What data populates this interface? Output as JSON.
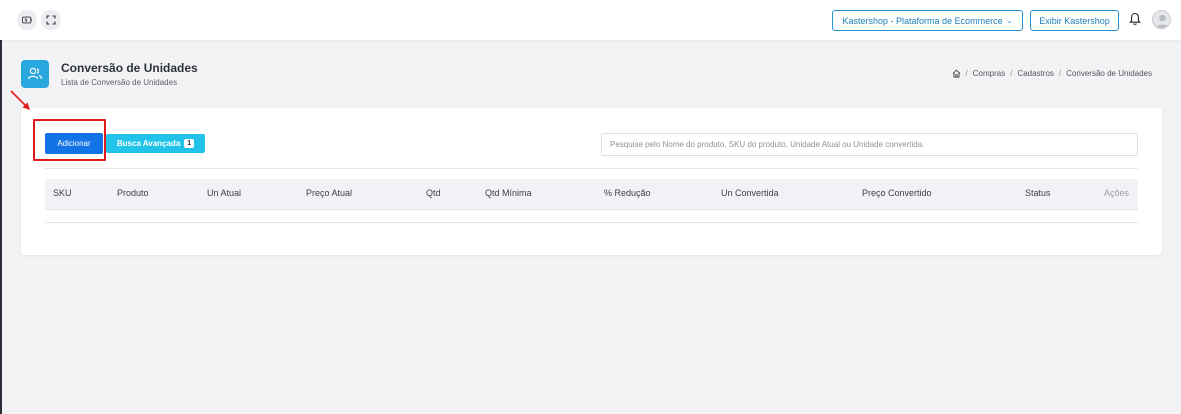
{
  "topbar": {
    "store_selector": "Kastershop - Plataforma de Ecommerce",
    "show_store_button": "Exibir Kastershop"
  },
  "header": {
    "title": "Conversão de Unidades",
    "subtitle": "Lista de Conversão de Unidades",
    "breadcrumb": [
      "Compras",
      "Cadastros",
      "Conversão de Unidades"
    ]
  },
  "toolbar": {
    "add_label": "Adicionar",
    "advanced_search_label": "Busca Avançada",
    "advanced_search_count": "1",
    "search_placeholder": "Pesquise pelo Nome do produto, SKU do produto, Unidade Atual ou Unidade convertida."
  },
  "table": {
    "columns": [
      "SKU",
      "Produto",
      "Un Atual",
      "Preço Atual",
      "Qtd",
      "Qtd Mínima",
      "% Redução",
      "Un Convertida",
      "Preço Convertido",
      "Status",
      "Ações"
    ],
    "rows": []
  },
  "colors": {
    "primary": "#1173e6",
    "info": "#21c3e8",
    "accent": "#29a8e0",
    "highlight": "#e01b1b"
  },
  "icons": [
    "battery-icon",
    "fullscreen-icon",
    "chevron-down-icon",
    "bell-icon",
    "avatar",
    "users-icon",
    "home-icon",
    "red-arrow-icon"
  ]
}
